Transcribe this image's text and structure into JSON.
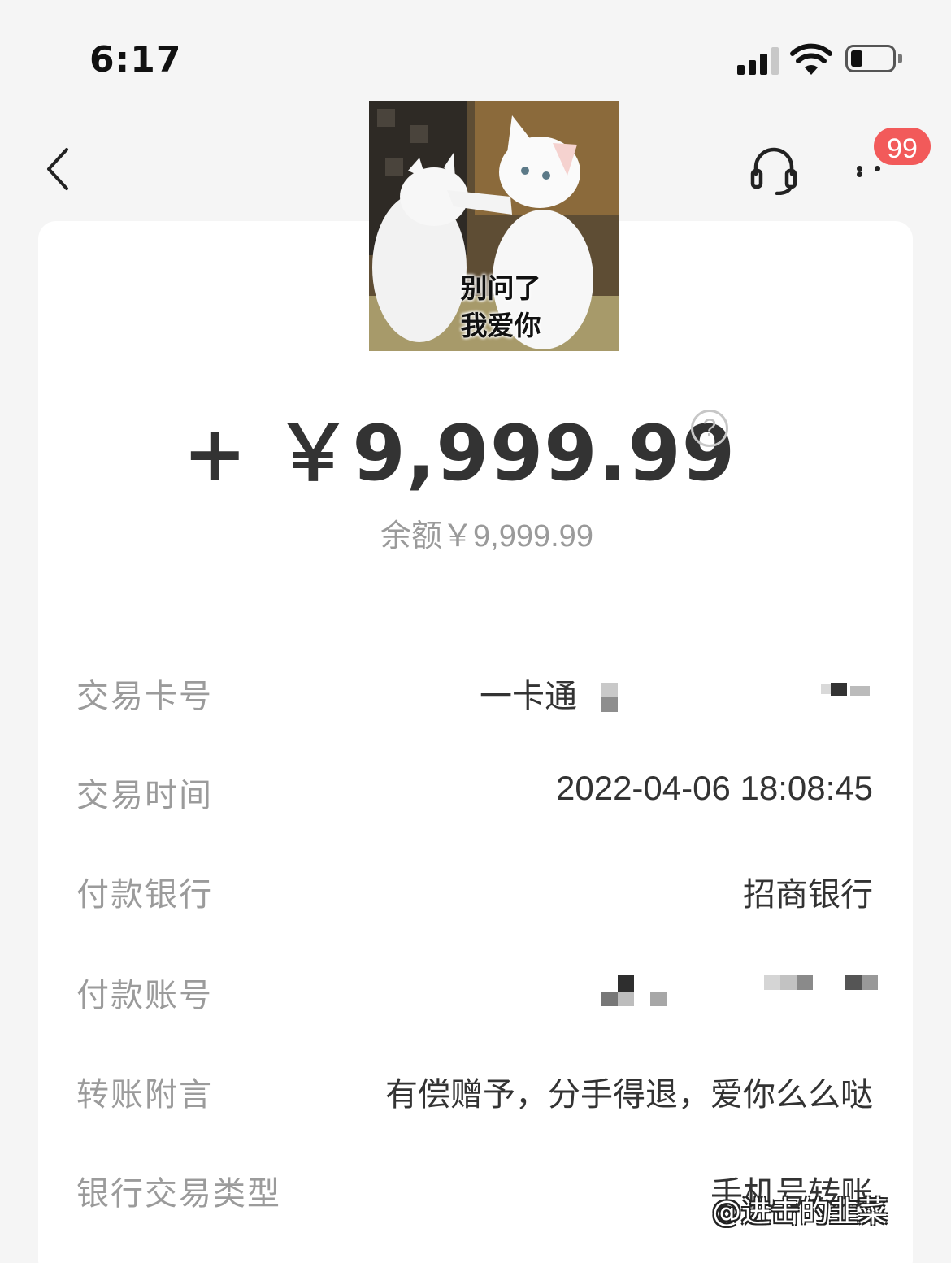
{
  "status_bar": {
    "time": "6:17"
  },
  "header": {
    "back_icon": "chevron-left-icon",
    "support_icon": "headset-icon",
    "more_icon": "more-dots-icon",
    "badge_count": "99",
    "badge_color": "#f25a5a"
  },
  "meme": {
    "caption_line1": "别问了",
    "caption_line2": "我爱你"
  },
  "amount": {
    "value": "+ ￥9,999.99",
    "help_symbol": "?"
  },
  "balance": {
    "text": "余额￥9,999.99"
  },
  "details": {
    "rows": [
      {
        "label": "交易卡号",
        "value": "一卡通"
      },
      {
        "label": "交易时间",
        "value": "2022-04-06 18:08:45"
      },
      {
        "label": "付款银行",
        "value": "招商银行"
      },
      {
        "label": "付款账号",
        "value": ""
      },
      {
        "label": "转账附言",
        "value": "有偿赠予，分手得退，爱你么么哒"
      },
      {
        "label": "银行交易类型",
        "value": "手机号转账"
      }
    ]
  },
  "watermark": {
    "text": "@进击的韭菜"
  }
}
